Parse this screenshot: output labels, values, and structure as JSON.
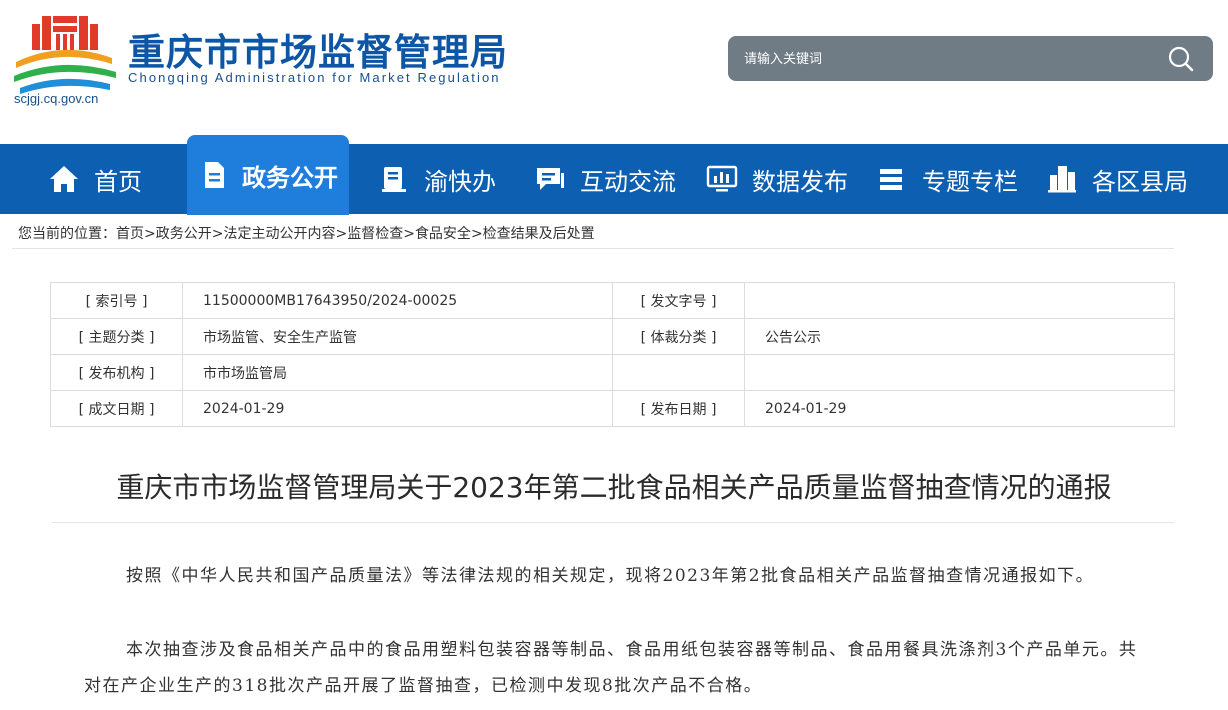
{
  "header": {
    "site_title": "重庆市市场监督管理局",
    "site_subtitle": "Chongqing  Administration for Market Regulation",
    "site_url": "scjgj.cq.gov.cn"
  },
  "search": {
    "placeholder": "请输入关键词"
  },
  "nav": {
    "items": [
      {
        "label": "首页",
        "icon": "home-icon"
      },
      {
        "label": "政务公开",
        "icon": "document-icon",
        "active": true
      },
      {
        "label": "渝快办",
        "icon": "book-icon"
      },
      {
        "label": "互动交流",
        "icon": "chat-icon"
      },
      {
        "label": "数据发布",
        "icon": "chart-monitor-icon"
      },
      {
        "label": "专题专栏",
        "icon": "layers-icon"
      },
      {
        "label": "各区县局",
        "icon": "buildings-icon"
      }
    ]
  },
  "breadcrumb": {
    "prefix": "您当前的位置：",
    "items": [
      "首页",
      "政务公开",
      "法定主动公开内容",
      "监督检查",
      "食品安全",
      "检查结果及后处置"
    ],
    "separator": ">"
  },
  "meta": {
    "index_label": "[ 索引号 ]",
    "index_value": "11500000MB17643950/2024-00025",
    "docno_label": "[ 发文字号 ]",
    "docno_value": "",
    "topic_label": "[ 主题分类 ]",
    "topic_value": "市场监管、安全生产监管",
    "genre_label": "[ 体裁分类 ]",
    "genre_value": "公告公示",
    "org_label": "[ 发布机构 ]",
    "org_value": "市市场监管局",
    "created_label": "[ 成文日期 ]",
    "created_value": "2024-01-29",
    "published_label": "[ 发布日期 ]",
    "published_value": "2024-01-29"
  },
  "article": {
    "title": "重庆市市场监督管理局关于2023年第二批食品相关产品质量监督抽查情况的通报",
    "paragraphs": [
      "按照《中华人民共和国产品质量法》等法律法规的相关规定，现将2023年第2批食品相关产品监督抽查情况通报如下。",
      "本次抽查涉及食品相关产品中的食品用塑料包装容器等制品、食品用纸包装容器等制品、食品用餐具洗涤剂3个产品单元。共对在产企业生产的318批次产品开展了监督抽查，已检测中发现8批次产品不合格。"
    ]
  },
  "colors": {
    "nav_bg": "#0d5fb2",
    "nav_active": "#1f7ddc",
    "brand_blue": "#0d56a6",
    "search_bg": "#6f7c86"
  }
}
